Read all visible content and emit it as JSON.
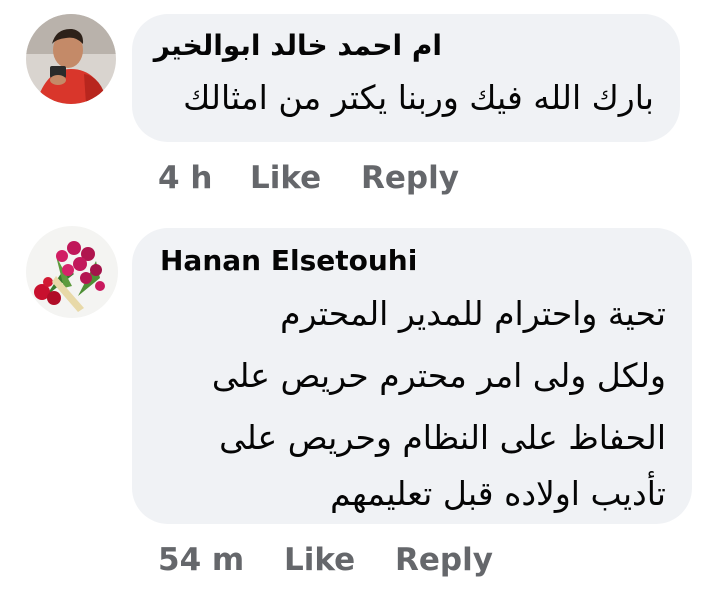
{
  "comments": [
    {
      "author": "ام احمد خالد ابوالخير",
      "lines": [
        "بارك الله فيك وربنا يكتر من امثالك"
      ],
      "time": "4 h",
      "like_label": "Like",
      "reply_label": "Reply",
      "avatar_icon": "profile-photo-man-red-shirt"
    },
    {
      "author": "Hanan Elsetouhi",
      "lines": [
        "تحية  واحترام للمدير المحترم",
        "ولكل ولى امر محترم حريص على",
        "الحفاظ على النظام وحريص على",
        "تأديب اولاده قبل تعليمهم"
      ],
      "time": "54 m",
      "like_label": "Like",
      "reply_label": "Reply",
      "avatar_icon": "profile-photo-flower-bouquet"
    }
  ],
  "colors": {
    "bubble": "#f0f2f5",
    "text": "#050505",
    "meta": "#65676b"
  }
}
